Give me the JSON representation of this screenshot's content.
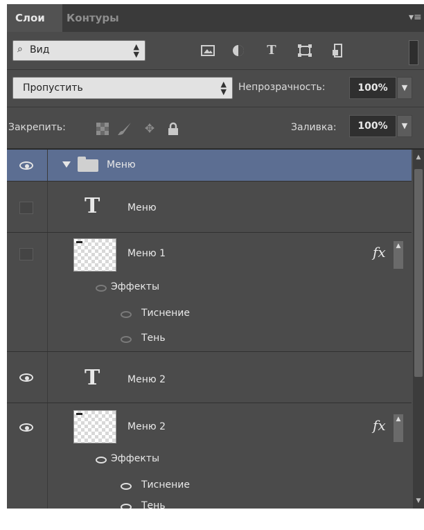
{
  "tabs": {
    "layers": "Слои",
    "paths": "Контуры"
  },
  "icons": {
    "panel_menu": "panel-menu-icon",
    "search": "search-icon",
    "filter_pixel": "image-layer-filter-icon",
    "filter_adjustment": "adjustment-layer-filter-icon",
    "filter_type": "type-layer-filter-icon",
    "filter_shape": "shape-layer-filter-icon",
    "filter_smart": "smart-object-filter-icon",
    "lock_transparent": "lock-transparent-pixels-icon",
    "lock_image": "lock-image-pixels-icon",
    "lock_position": "lock-position-icon",
    "lock_all": "lock-all-icon",
    "eye": "eye-icon",
    "folder": "folder-icon",
    "type": "type-layer-icon",
    "fx": "fx-icon"
  },
  "filter": {
    "kind_label": "Вид",
    "type_glyph": "T"
  },
  "blend": {
    "mode": "Пропустить",
    "opacity_label": "Непрозрачность:",
    "opacity_value": "100%"
  },
  "lock": {
    "label": "Закрепить:"
  },
  "fill": {
    "label": "Заливка:",
    "value": "100%"
  },
  "colors": {
    "selected_row": "#5c6e92",
    "panel_bg": "#4b4b4b"
  },
  "layers": [
    {
      "name": "Меню",
      "kind": "group",
      "visible": true,
      "expanded": true,
      "selected": true
    },
    {
      "name": "Меню",
      "kind": "text",
      "visible": false,
      "type_glyph": "T"
    },
    {
      "name": "Меню 1",
      "kind": "pixel",
      "visible": false,
      "fx_label": "fx",
      "effects_label": "Эффекты",
      "effects": [
        "Тиснение",
        "Тень"
      ]
    },
    {
      "name": "Меню 2",
      "kind": "text",
      "visible": true,
      "type_glyph": "T"
    },
    {
      "name": "Меню 2",
      "kind": "pixel",
      "visible": true,
      "fx_label": "fx",
      "effects_label": "Эффекты",
      "effects": [
        "Тиснение",
        "Тень"
      ]
    }
  ]
}
